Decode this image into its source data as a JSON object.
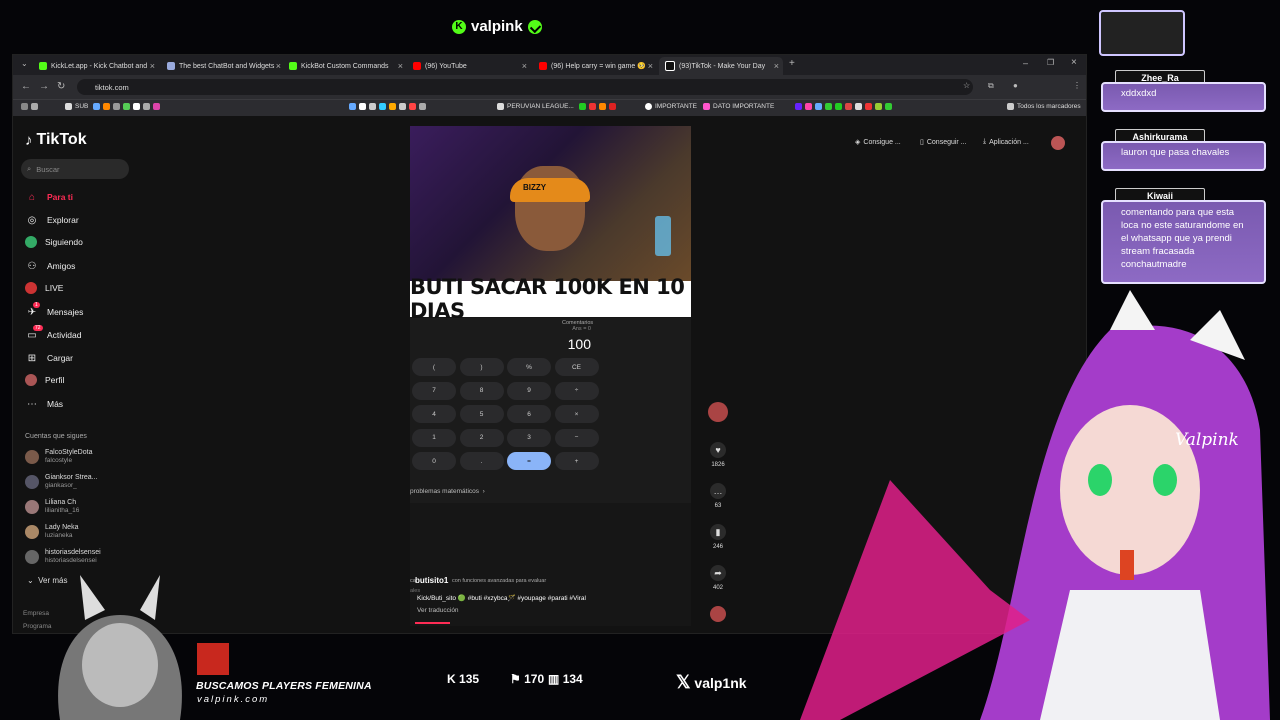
{
  "stream": {
    "channel": "valpink",
    "brand_color": "#53fc18",
    "bottom_title": "BUSCAMOS PLAYERS FEMENINA",
    "bottom_site": "valpink.com",
    "stats": {
      "kick": "135",
      "likes": "170",
      "viewers": "134"
    },
    "x_handle": "valp1nk",
    "avatar_watermark": "Valpink"
  },
  "browser": {
    "tabs": [
      {
        "title": "KickLet.app - Kick Chatbot and",
        "icon": "k-icon"
      },
      {
        "title": "The best ChatBot and Widgets",
        "icon": "diamond-icon"
      },
      {
        "title": "KickBot Custom Commands",
        "icon": "k-icon"
      },
      {
        "title": "(96) YouTube",
        "icon": "youtube-icon"
      },
      {
        "title": "(96) Help carry = win game 🥺",
        "icon": "youtube-icon"
      },
      {
        "title": "(93)TikTok - Make Your Day",
        "icon": "tiktok-icon"
      }
    ],
    "url": "tiktok.com",
    "bookmarks": [
      "SUB",
      "PERUVIAN LEAGUE...",
      "IMPORTANTE",
      "DATO IMPORTANTE",
      "Todos los marcadores"
    ]
  },
  "tiktok": {
    "logo": "TikTok",
    "search_placeholder": "Buscar",
    "nav": [
      "Para ti",
      "Explorar",
      "Siguiendo",
      "Amigos",
      "LIVE",
      "Mensajes",
      "Actividad",
      "Cargar",
      "Perfil",
      "Más"
    ],
    "badges": {
      "mensajes": "1",
      "actividad": "72"
    },
    "following_header": "Cuentas que sigues",
    "following": [
      {
        "name": "FalcoStyleDota",
        "user": "falcostyle"
      },
      {
        "name": "Gianksor Strea...",
        "user": "giankasor_"
      },
      {
        "name": "Liliana Ch",
        "user": "lilianitha_16"
      },
      {
        "name": "Lady Neka",
        "user": "luzianeka"
      },
      {
        "name": "historiasdelsensei",
        "user": "historiasdelsensei"
      }
    ],
    "see_more": "Ver más",
    "footer": [
      "Empresa",
      "Programa"
    ],
    "header_buttons": [
      "Consigue ...",
      "Conseguir ...",
      "Aplicación ..."
    ],
    "video": {
      "caption": "BUTI SACAR 100K EN 10 DIAS",
      "cap_text": "BIZZY",
      "calc_ans": "Ans = 0",
      "calc_display": "100",
      "keys": [
        "(",
        ")",
        "%",
        "CE",
        "7",
        "8",
        "9",
        "÷",
        "4",
        "5",
        "6",
        "×",
        "1",
        "2",
        "3",
        "−",
        "0",
        ".",
        "=",
        "+"
      ],
      "problems_link": "problemas matemáticos",
      "comments_label": "Comentarios",
      "author": "butisito1",
      "desc_prefix": "ca",
      "desc": "con funciones avanzadas para evaluar",
      "desc_extra": "ales",
      "tags": "Kick/Buti_sito 🟢 #buti #xzybca🪄 #youpage #parati #Viral",
      "see_translation": "Ver traducción"
    },
    "actions": {
      "likes": "1826",
      "comments": "63",
      "saves": "246",
      "shares": "402"
    }
  },
  "chat": [
    {
      "user": "Zhee_Ra",
      "text": "xddxdxd"
    },
    {
      "user": "Ashirkurama",
      "text": "lauron que pasa chavales"
    },
    {
      "user": "Kiwaii",
      "text": "comentando para que esta loca no este saturandome en el whatsapp que ya prendi stream fracasada conchautmadre"
    }
  ]
}
